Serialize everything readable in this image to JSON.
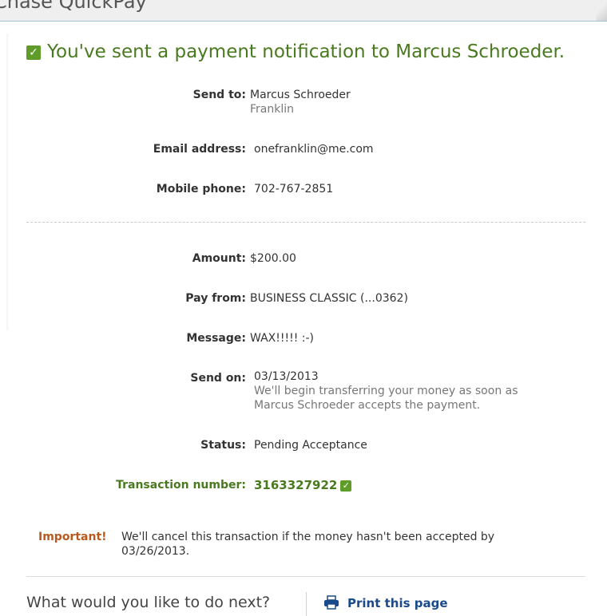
{
  "app": {
    "title": "Chase QuickPay"
  },
  "confirmation": {
    "headline": "You've sent a payment notification to Marcus Schroeder.",
    "icon": "check-icon"
  },
  "recipient": {
    "send_to_label": "Send to:",
    "send_to_name": "Marcus Schroeder",
    "send_to_nickname": "Franklin",
    "email_label": "Email address:",
    "email_value": "onefranklin@me.com",
    "phone_label": "Mobile phone:",
    "phone_value": "702-767-2851"
  },
  "payment": {
    "amount_label": "Amount:",
    "amount_value": "$200.00",
    "pay_from_label": "Pay from:",
    "pay_from_value": "BUSINESS CLASSIC (...0362)",
    "message_label": "Message:",
    "message_value": "WAX!!!!! :-)",
    "send_on_label": "Send on:",
    "send_on_date": "03/13/2013",
    "send_on_note_1": "We'll begin transferring your money as soon as",
    "send_on_note_2": "Marcus Schroeder accepts the payment.",
    "status_label": "Status:",
    "status_value": "Pending Acceptance",
    "transaction_label": "Transaction number:",
    "transaction_value": "3163327922"
  },
  "important": {
    "label": "Important!",
    "text": "We'll cancel this transaction if the money hasn't been accepted by 03/26/2013."
  },
  "footer": {
    "next_prompt": "What would you like to do next?",
    "print_label": "Print this page",
    "print_icon": "printer-icon"
  },
  "colors": {
    "success_green": "#4a7a1f",
    "important_orange": "#b85a1f",
    "link_blue": "#1a4a8a"
  }
}
